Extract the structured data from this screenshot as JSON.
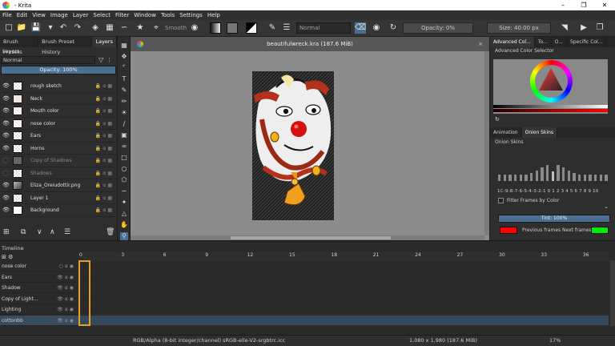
{
  "window": {
    "title": "- Krita"
  },
  "menu": [
    "File",
    "Edit",
    "View",
    "Image",
    "Layer",
    "Select",
    "Filter",
    "Window",
    "Tools",
    "Settings",
    "Help"
  ],
  "toolbar": {
    "smooth_label": "Smooth",
    "blend_mode": "Normal",
    "opacity": "Opacity: 0%",
    "size": "Size: 40.00 px"
  },
  "left_dock": {
    "tabs": [
      "Brush Presets",
      "Brush Preset History",
      "Layers"
    ],
    "active_tab": "Layers",
    "title": "Layers",
    "blend_mode": "Normal",
    "opacity": "Opacity: 100%",
    "layers": [
      {
        "name": "rough sketch",
        "visible": true,
        "thumb": "checker",
        "selected": false
      },
      {
        "name": "Neck",
        "visible": true,
        "thumb": "neck",
        "selected": false
      },
      {
        "name": "Mouth color",
        "visible": true,
        "thumb": "mouth",
        "selected": false
      },
      {
        "name": "nose color",
        "visible": true,
        "thumb": "nose",
        "selected": false
      },
      {
        "name": "Ears",
        "visible": true,
        "thumb": "checker",
        "selected": false
      },
      {
        "name": "Horns",
        "visible": true,
        "thumb": "checker",
        "selected": false
      },
      {
        "name": "Copy of Shadows",
        "visible": false,
        "thumb": "dark",
        "selected": false
      },
      {
        "name": "Shadows",
        "visible": false,
        "thumb": "checker",
        "selected": false
      },
      {
        "name": "Eliza_Oreiudottir.png",
        "visible": true,
        "thumb": "photo",
        "selected": false
      },
      {
        "name": "Layer 1",
        "visible": true,
        "thumb": "checker",
        "selected": false
      },
      {
        "name": "Background",
        "visible": true,
        "thumb": "white",
        "selected": false
      }
    ]
  },
  "canvas": {
    "document_title": "beautifulwreck.kra (187.6 MiB)",
    "close": "×"
  },
  "right_dock": {
    "tabs": [
      "Advanced Col...",
      "To...",
      "O...",
      "Specific Col..."
    ],
    "section_title": "Advanced Color Selector",
    "lower_tabs": [
      "Animation",
      "Onion Skins"
    ],
    "onion_title": "Onion Skins",
    "frames": "1C-9-8-7-6-5-4-3-2-1  0  1 2 3 4 5 6 7 8 9 10",
    "opacity_bars": [
      0.35,
      0.35,
      0.35,
      0.35,
      0.35,
      0.35,
      0.4,
      0.55,
      0.7,
      0.85,
      0.5,
      0.85,
      0.7,
      0.55,
      0.4,
      0.35,
      0.35,
      0.35,
      0.35,
      0.35,
      0.35
    ],
    "filter_label": "Filter Frames by Color",
    "tint": "Tint: 100%",
    "previous_frames": "Previous frames",
    "next_frames": "Next frames",
    "previous_color": "#ff0000",
    "next_color": "#00ee00"
  },
  "timeline": {
    "title": "Timeline",
    "ticks": [
      "0",
      "3",
      "6",
      "9",
      "12",
      "15",
      "18",
      "21",
      "24",
      "27",
      "30",
      "33",
      "36"
    ],
    "layers": [
      {
        "name": "nose color",
        "selected": false
      },
      {
        "name": "Ears",
        "selected": false
      },
      {
        "name": "Shadow",
        "selected": false
      },
      {
        "name": "Copy of Light...",
        "selected": false
      },
      {
        "name": "Lighting",
        "selected": false
      },
      {
        "name": "cottonbb",
        "selected": true
      }
    ]
  },
  "status": {
    "color_space": "RGB/Alpha (8-bit integer/channel)  sRGB-elle-V2-srgbtrc.icc",
    "dimensions": "1,080 x 1,980 (187.6 MiB)",
    "zoom": "17%"
  },
  "colors": {
    "accent": "#4b6f91",
    "playhead": "#e7a020"
  }
}
